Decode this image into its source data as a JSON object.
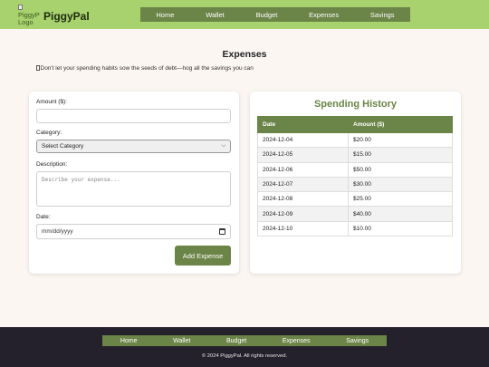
{
  "header": {
    "logo_alt": "PiggyPal Logo",
    "brand": "PiggyPal",
    "nav": [
      "Home",
      "Wallet",
      "Budget",
      "Expenses",
      "Savings"
    ]
  },
  "main": {
    "title": "Expenses",
    "tagline": "Don't let your spending habits sow the seeds of debt—hog all the savings you can"
  },
  "form": {
    "amount_label": "Amount ($):",
    "amount_value": "",
    "category_label": "Category:",
    "category_selected": "Select Category",
    "description_label": "Description:",
    "description_placeholder": "Describe your expense...",
    "date_label": "Date:",
    "date_placeholder": "mm/dd/yyyy",
    "submit_label": "Add Expense"
  },
  "history": {
    "title": "Spending History",
    "columns": [
      "Date",
      "Amount ($)"
    ],
    "rows": [
      [
        "2024-12-04",
        "$20.00"
      ],
      [
        "2024-12-05",
        "$15.00"
      ],
      [
        "2024-12-06",
        "$50.00"
      ],
      [
        "2024-12-07",
        "$30.00"
      ],
      [
        "2024-12-08",
        "$25.00"
      ],
      [
        "2024-12-09",
        "$40.00"
      ],
      [
        "2024-12-10",
        "$10.00"
      ]
    ]
  },
  "footer": {
    "nav": [
      "Home",
      "Wallet",
      "Budget",
      "Expenses",
      "Savings"
    ],
    "copyright": "© 2024 PiggyPal. All rights reserved."
  },
  "colors": {
    "header_bg": "#a8d26e",
    "accent": "#6b8447",
    "footer_bg": "#24202c",
    "page_bg": "#fbf6f2"
  }
}
